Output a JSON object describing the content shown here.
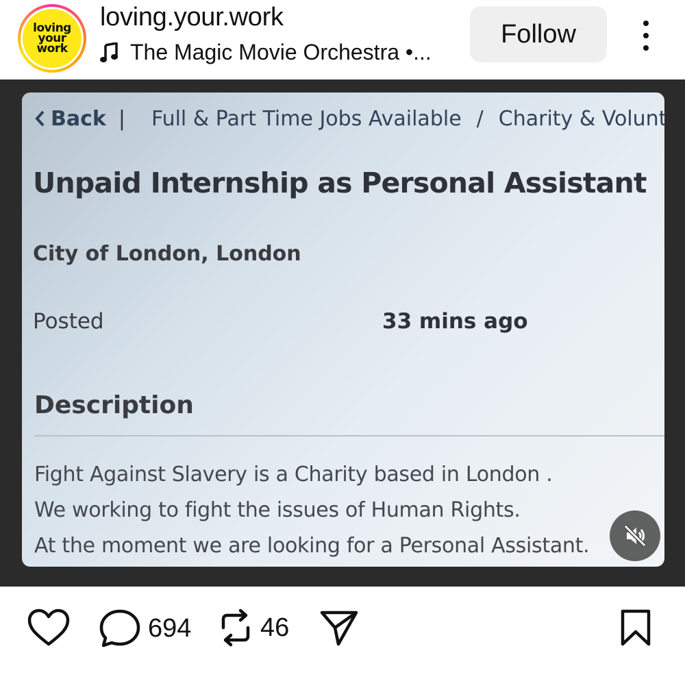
{
  "header": {
    "avatar_lines": [
      "loving",
      "your",
      "work"
    ],
    "username": "loving.your.work",
    "music_text": "The Magic Movie Orchestra •...",
    "follow_label": "Follow"
  },
  "post": {
    "breadcrumb": {
      "back_label": "Back",
      "separator": "|",
      "category": "Full & Part Time Jobs Available",
      "divider": "/",
      "subcategory": "Charity & Volunt"
    },
    "job_title": "Unpaid Internship as Personal Assistant",
    "location": "City of London, London",
    "posted_label": "Posted",
    "posted_value": "33 mins ago",
    "description_heading": "Description",
    "description_lines": [
      "Fight Against Slavery is a Charity based in London .",
      "We working to fight the issues of Human Rights.",
      "At the moment we are looking for a Personal Assistant."
    ]
  },
  "actions": {
    "comments_count": "694",
    "reposts_count": "46"
  },
  "icons": {
    "music": "music-note-icon",
    "more": "more-vertical-icon",
    "mute": "speaker-muted-icon",
    "like": "heart-icon",
    "comment": "comment-bubble-icon",
    "repost": "repost-icon",
    "share": "send-paper-plane-icon",
    "save": "bookmark-icon"
  },
  "colors": {
    "avatar_bg": "#ffe81a",
    "ring": [
      "#ff2d9b",
      "#ff9a00",
      "#ffe600"
    ],
    "follow_bg": "#efefef",
    "media_bg": "#2b2b2b",
    "link_text": "#31435a"
  }
}
